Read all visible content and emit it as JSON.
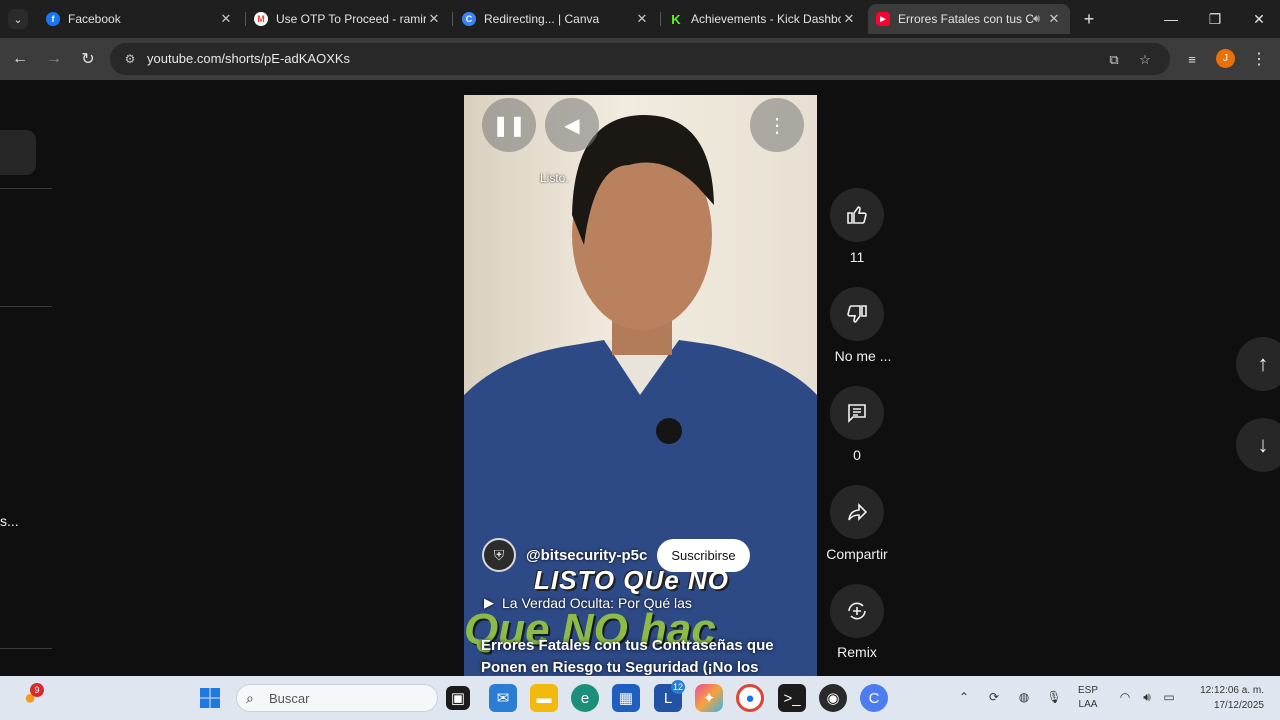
{
  "browser": {
    "tabs": [
      {
        "title": "Facebook",
        "favicon": "facebook-icon",
        "color": "#1877f2",
        "glyph": "f"
      },
      {
        "title": "Use OTP To Proceed - ramir",
        "favicon": "gmail-icon",
        "color": "#ea4335",
        "glyph": "M"
      },
      {
        "title": "Redirecting... | Canva",
        "favicon": "canva-icon",
        "color": "#3b82f6",
        "glyph": "C"
      },
      {
        "title": "Achievements - Kick Dashbo",
        "favicon": "kick-icon",
        "color": "#53fc18",
        "glyph": "K"
      },
      {
        "title": "Errores Fatales con tus C",
        "favicon": "youtube-icon",
        "color": "#ff0033",
        "glyph": "▶"
      }
    ],
    "url": "youtube.com/shorts/pE-adKAOXKs",
    "profile_initial": "J"
  },
  "sidebar": {
    "truncated_text": "s..."
  },
  "video": {
    "tooltip": "Listo.",
    "channel_handle": "@bitsecurity-p5c",
    "subscribe_label": "Suscribirse",
    "overlay_caption": "LISTO QUe NO",
    "overlay_caption2": "Que NO hac",
    "playlist_label": "La Verdad Oculta: Por Qué las",
    "title": "Errores Fatales con tus Contraseñas que Ponen en Riesgo tu Seguridad (¡No los"
  },
  "actions": {
    "like_count": "11",
    "dislike_label": "No me ...",
    "comment_count": "0",
    "share_label": "Compartir",
    "remix_label": "Remix"
  },
  "taskbar": {
    "weather_badge": "9",
    "search_placeholder": "Buscar",
    "outlook_badge": "12",
    "language_top": "ESP",
    "language_bottom": "LAA",
    "time": "12:12:06 a. m.",
    "date": "17/12/2025"
  },
  "colors": {
    "accent_youtube": "#ff0033",
    "taskbar": "#dfe6ef",
    "page_bg": "#0f0f0f"
  }
}
